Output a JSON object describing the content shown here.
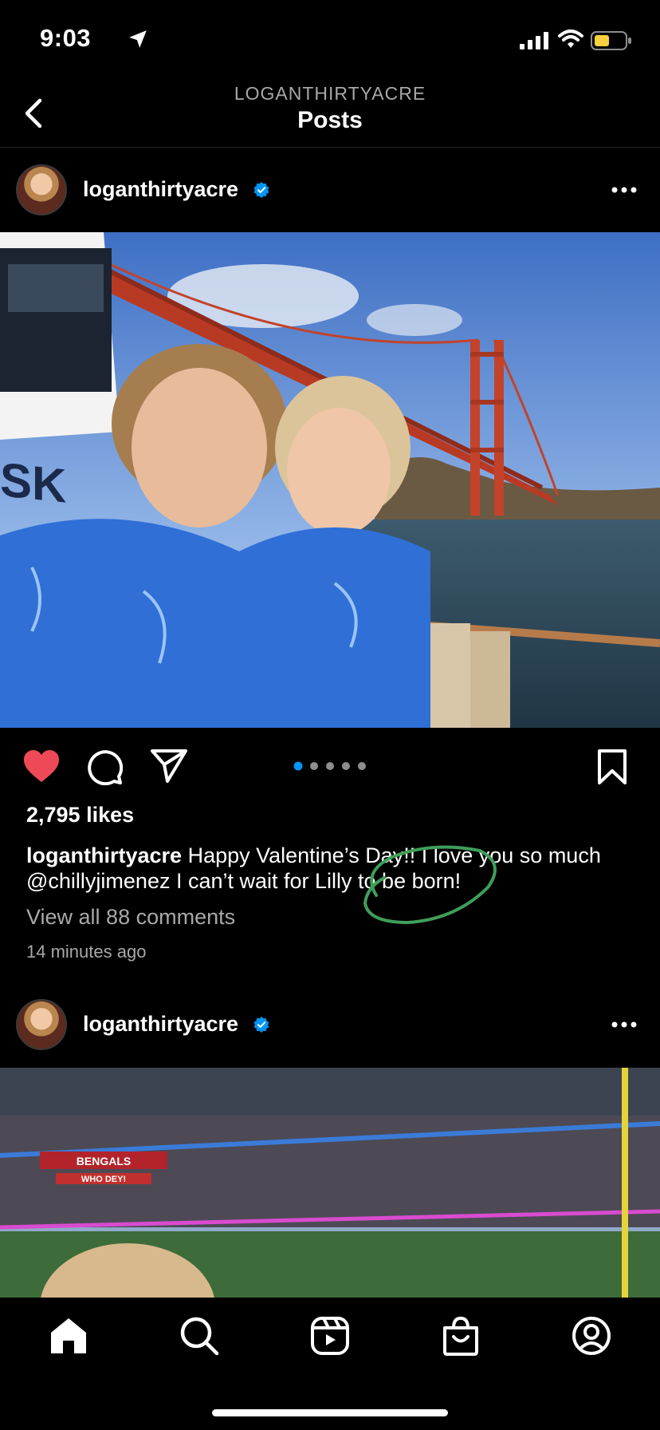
{
  "status_bar": {
    "time": "9:03"
  },
  "header": {
    "subtitle": "LOGANTHIRTYACRE",
    "title": "Posts"
  },
  "post1": {
    "username": "loganthirtyacre",
    "likes": "2,795 likes",
    "caption_user": "loganthirtyacre",
    "caption_text": " Happy Valentine’s Day!! I love you so much @chillyjimenez I can’t wait for Lilly to be born!",
    "view_comments": "View all 88 comments",
    "timestamp": "14 minutes ago",
    "carousel": {
      "count": 5,
      "active": 1
    },
    "liked": true
  },
  "post2": {
    "username": "loganthirtyacre",
    "stadium_banner_1": "BENGALS",
    "stadium_banner_2": "WHO DEY!"
  },
  "icons": {
    "location": "location-arrow-icon",
    "signal": "cellular-signal-icon",
    "wifi": "wifi-icon",
    "battery": "battery-icon",
    "back": "chevron-left-icon",
    "verified": "verified-badge-icon",
    "more": "more-horizontal-icon",
    "like": "heart-icon",
    "comment": "comment-icon",
    "share": "paper-plane-icon",
    "save": "bookmark-icon",
    "tabs": [
      "home-icon",
      "search-icon",
      "reels-icon",
      "shop-icon",
      "profile-icon"
    ]
  },
  "colors": {
    "accent_blue": "#0095f6",
    "like_red": "#ed4956",
    "muted": "#a8a8a8",
    "annotation": "#3f9e5a"
  }
}
